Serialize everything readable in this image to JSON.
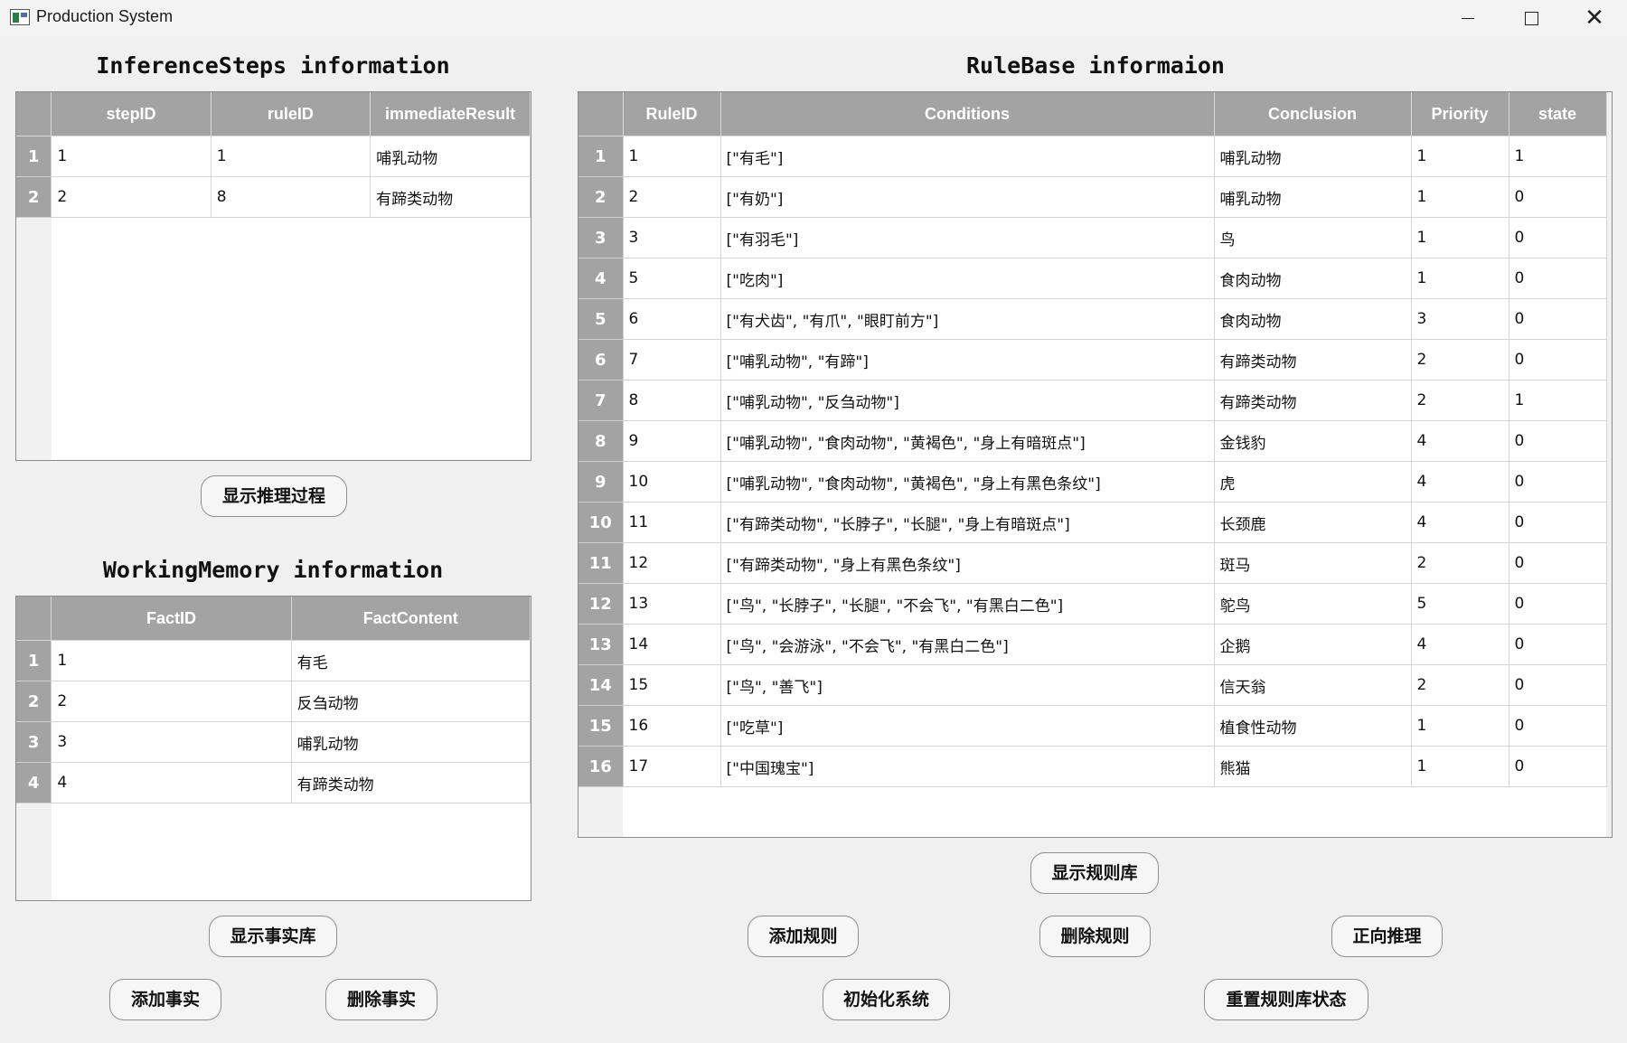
{
  "window": {
    "title": "Production System",
    "minimize_icon": "minimize-icon",
    "maximize_icon": "maximize-icon",
    "close_icon": "close-icon",
    "close_glyph": "✕"
  },
  "inference": {
    "title": "InferenceSteps information",
    "headers": [
      "stepID",
      "ruleID",
      "immediateResult"
    ],
    "rows": [
      {
        "n": "1",
        "stepID": "1",
        "ruleID": "1",
        "immediateResult": "哺乳动物"
      },
      {
        "n": "2",
        "stepID": "2",
        "ruleID": "8",
        "immediateResult": "有蹄类动物"
      }
    ],
    "show_button": "显示推理过程"
  },
  "memory": {
    "title": "WorkingMemory information",
    "headers": [
      "FactID",
      "FactContent"
    ],
    "rows": [
      {
        "n": "1",
        "FactID": "1",
        "FactContent": "有毛"
      },
      {
        "n": "2",
        "FactID": "2",
        "FactContent": "反刍动物"
      },
      {
        "n": "3",
        "FactID": "3",
        "FactContent": "哺乳动物"
      },
      {
        "n": "4",
        "FactID": "4",
        "FactContent": "有蹄类动物"
      }
    ],
    "show_button": "显示事实库",
    "add_button": "添加事实",
    "delete_button": "删除事实"
  },
  "rulebase": {
    "title": "RuleBase informaion",
    "headers": [
      "RuleID",
      "Conditions",
      "Conclusion",
      "Priority",
      "state"
    ],
    "rows": [
      {
        "n": "1",
        "RuleID": "1",
        "Conditions": "[\"有毛\"]",
        "Conclusion": "哺乳动物",
        "Priority": "1",
        "state": "1"
      },
      {
        "n": "2",
        "RuleID": "2",
        "Conditions": "[\"有奶\"]",
        "Conclusion": "哺乳动物",
        "Priority": "1",
        "state": "0"
      },
      {
        "n": "3",
        "RuleID": "3",
        "Conditions": "[\"有羽毛\"]",
        "Conclusion": "鸟",
        "Priority": "1",
        "state": "0"
      },
      {
        "n": "4",
        "RuleID": "5",
        "Conditions": "[\"吃肉\"]",
        "Conclusion": "食肉动物",
        "Priority": "1",
        "state": "0"
      },
      {
        "n": "5",
        "RuleID": "6",
        "Conditions": "[\"有犬齿\", \"有爪\", \"眼盯前方\"]",
        "Conclusion": "食肉动物",
        "Priority": "3",
        "state": "0"
      },
      {
        "n": "6",
        "RuleID": "7",
        "Conditions": "[\"哺乳动物\", \"有蹄\"]",
        "Conclusion": "有蹄类动物",
        "Priority": "2",
        "state": "0"
      },
      {
        "n": "7",
        "RuleID": "8",
        "Conditions": "[\"哺乳动物\", \"反刍动物\"]",
        "Conclusion": "有蹄类动物",
        "Priority": "2",
        "state": "1"
      },
      {
        "n": "8",
        "RuleID": "9",
        "Conditions": "[\"哺乳动物\", \"食肉动物\", \"黄褐色\", \"身上有暗斑点\"]",
        "Conclusion": "金钱豹",
        "Priority": "4",
        "state": "0"
      },
      {
        "n": "9",
        "RuleID": "10",
        "Conditions": "[\"哺乳动物\", \"食肉动物\", \"黄褐色\", \"身上有黑色条纹\"]",
        "Conclusion": "虎",
        "Priority": "4",
        "state": "0"
      },
      {
        "n": "10",
        "RuleID": "11",
        "Conditions": "[\"有蹄类动物\", \"长脖子\", \"长腿\", \"身上有暗斑点\"]",
        "Conclusion": "长颈鹿",
        "Priority": "4",
        "state": "0"
      },
      {
        "n": "11",
        "RuleID": "12",
        "Conditions": "[\"有蹄类动物\", \"身上有黑色条纹\"]",
        "Conclusion": "斑马",
        "Priority": "2",
        "state": "0"
      },
      {
        "n": "12",
        "RuleID": "13",
        "Conditions": "[\"鸟\", \"长脖子\", \"长腿\", \"不会飞\", \"有黑白二色\"]",
        "Conclusion": "鸵鸟",
        "Priority": "5",
        "state": "0"
      },
      {
        "n": "13",
        "RuleID": "14",
        "Conditions": "[\"鸟\", \"会游泳\", \"不会飞\", \"有黑白二色\"]",
        "Conclusion": "企鹅",
        "Priority": "4",
        "state": "0"
      },
      {
        "n": "14",
        "RuleID": "15",
        "Conditions": "[\"鸟\", \"善飞\"]",
        "Conclusion": "信天翁",
        "Priority": "2",
        "state": "0"
      },
      {
        "n": "15",
        "RuleID": "16",
        "Conditions": "[\"吃草\"]",
        "Conclusion": "植食性动物",
        "Priority": "1",
        "state": "0"
      },
      {
        "n": "16",
        "RuleID": "17",
        "Conditions": "[\"中国瑰宝\"]",
        "Conclusion": "熊猫",
        "Priority": "1",
        "state": "0"
      }
    ],
    "show_button": "显示规则库",
    "add_button": "添加规则",
    "delete_button": "删除规则",
    "forward_button": "正向推理",
    "init_button": "初始化系统",
    "reset_button": "重置规则库状态"
  }
}
